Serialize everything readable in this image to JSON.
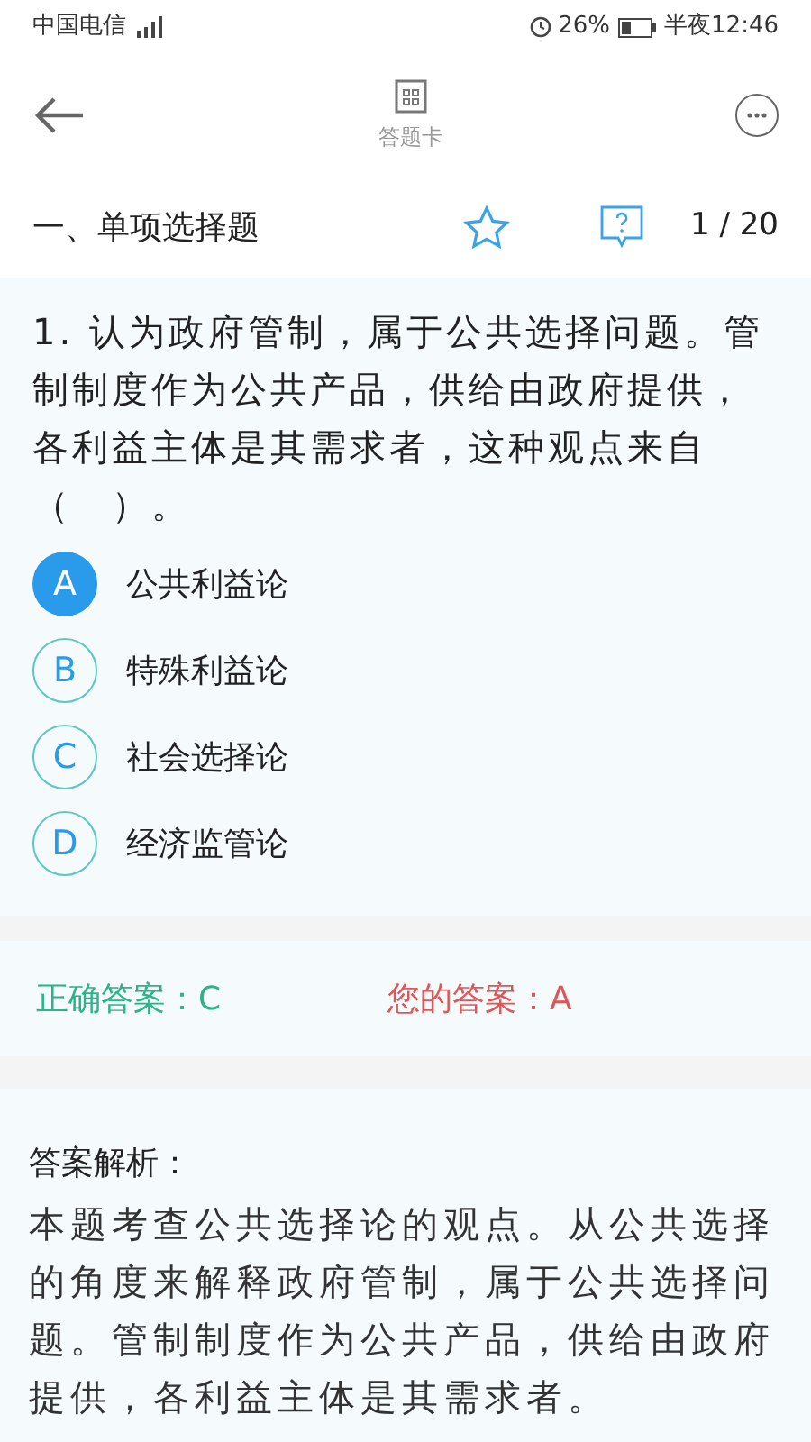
{
  "status_bar": {
    "carrier": "中国电信",
    "battery": "26%",
    "time": "半夜12:46"
  },
  "header": {
    "answer_card": "答题卡"
  },
  "section": {
    "title": "一、单项选择题",
    "starred": false,
    "progress": "1 / 20"
  },
  "question": {
    "text": "1. 认为政府管制，属于公共选择问题。管制制度作为公共产品，供给由政府提供，各利益主体是其需求者，这种观点来自（　）。",
    "options": [
      {
        "letter": "A",
        "text": "公共利益论",
        "selected": true
      },
      {
        "letter": "B",
        "text": "特殊利益论",
        "selected": false
      },
      {
        "letter": "C",
        "text": "社会选择论",
        "selected": false
      },
      {
        "letter": "D",
        "text": "经济监管论",
        "selected": false
      }
    ]
  },
  "answers": {
    "correct": "正确答案：C",
    "yours": "您的答案：A"
  },
  "explanation": {
    "heading": "答案解析：",
    "text": "本题考查公共选择论的观点。从公共选择的角度来解释政府管制，属于公共选择问题。管制制度作为公共产品，供给由政府提供，各利益主体是其需求者。"
  }
}
